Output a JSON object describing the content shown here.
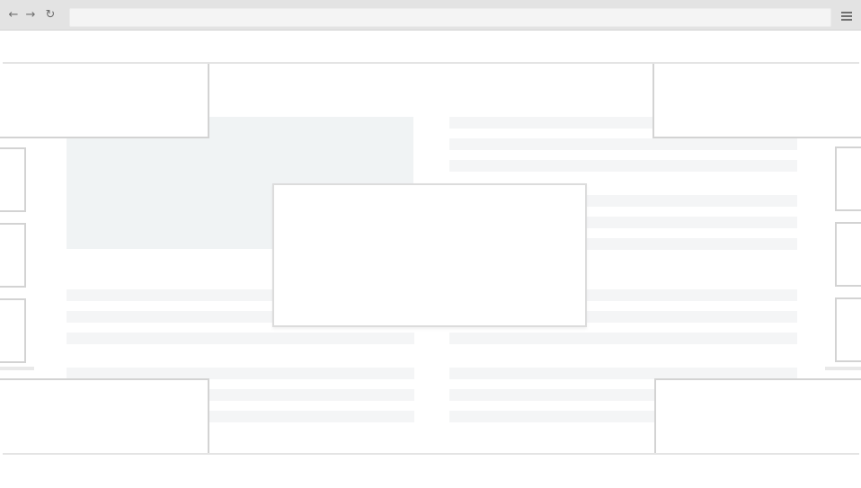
{
  "browser": {
    "icons": {
      "back": "arrow-left-icon",
      "forward": "arrow-right-icon",
      "reload": "reload-icon",
      "menu": "hamburger-menu-icon"
    },
    "address_value": ""
  },
  "page": {
    "dialog_text": ""
  }
}
